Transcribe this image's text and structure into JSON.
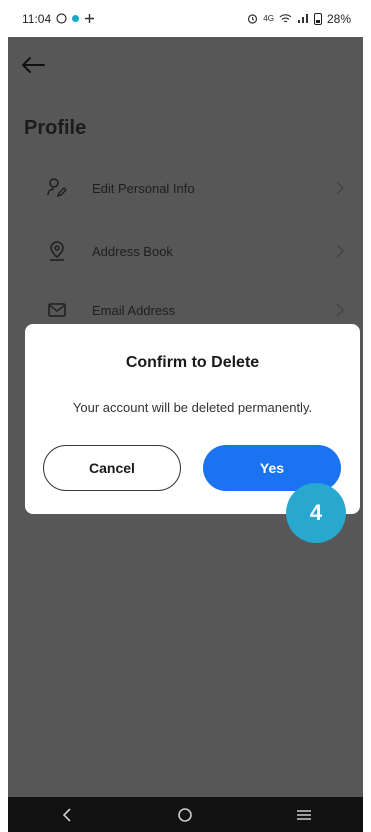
{
  "status_bar": {
    "time": "11:04",
    "right_text": "28%",
    "network_label": "4G"
  },
  "header": {
    "title": "Profile"
  },
  "menu": {
    "items": [
      {
        "label": "Edit Personal Info",
        "icon": "user-edit-icon"
      },
      {
        "label": "Address Book",
        "icon": "location-pin-icon"
      },
      {
        "label": "Email Address",
        "icon": "mail-icon"
      }
    ]
  },
  "dialog": {
    "title": "Confirm to Delete",
    "message": "Your account will be deleted permanently.",
    "cancel_label": "Cancel",
    "confirm_label": "Yes"
  },
  "step_badge": {
    "number": "4"
  },
  "colors": {
    "overlay": "#575757",
    "primary_button": "#1a73f0",
    "badge": "#29a8cf"
  }
}
